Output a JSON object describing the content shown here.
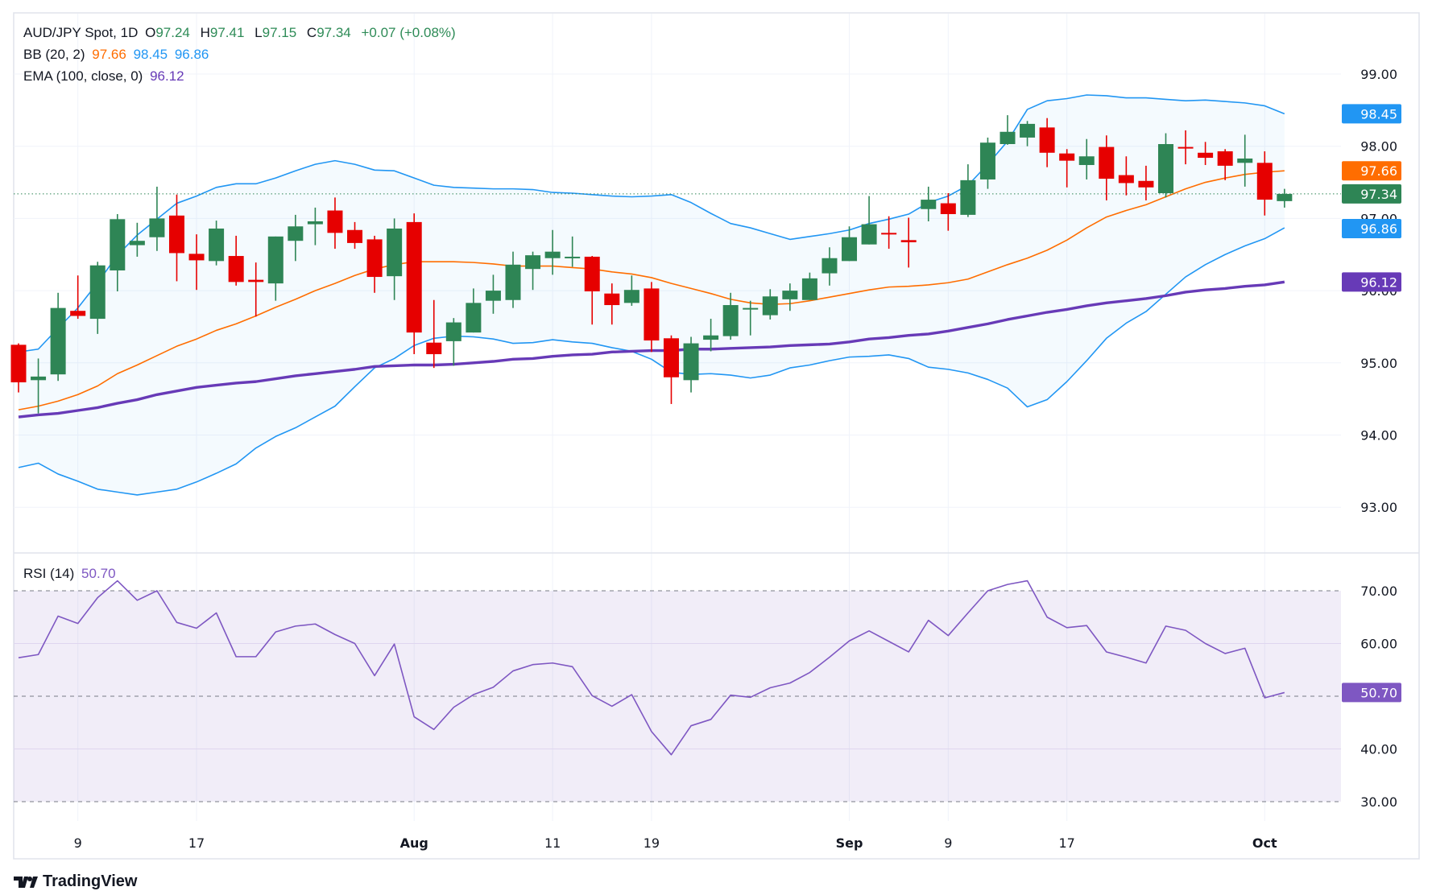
{
  "header": {
    "symbol": "AUD/JPY Spot, 1D",
    "open_label": "O",
    "open": "97.24",
    "high_label": "H",
    "high": "97.41",
    "low_label": "L",
    "low": "97.15",
    "close_label": "C",
    "close": "97.34",
    "change": "+0.07 (+0.08%)"
  },
  "bb_legend": {
    "label": "BB (20, 2)",
    "basis": "97.66",
    "upper": "98.45",
    "lower": "96.86"
  },
  "ema_legend": {
    "label": "EMA (100, close, 0)",
    "value": "96.12"
  },
  "rsi_legend": {
    "label": "RSI (14)",
    "value": "50.70"
  },
  "brand": "TradingView",
  "colors": {
    "up": "#2e8555",
    "down": "#e60000",
    "bb_band": "#2196f3",
    "bb_basis": "#ff6d00",
    "ema": "#673ab7",
    "rsi": "#7e57c2"
  },
  "chart_data": [
    {
      "type": "candlestick",
      "ylim": [
        92.4,
        99.6
      ],
      "price_ticks": [
        "99.00",
        "98.00",
        "97.00",
        "96.00",
        "95.00",
        "94.00",
        "93.00"
      ],
      "time_ticks": [
        {
          "label": "9",
          "date": "Jul 9"
        },
        {
          "label": "17",
          "date": "Jul 17"
        },
        {
          "label": "Aug",
          "date": "Aug 1"
        },
        {
          "label": "11",
          "date": "Aug 12"
        },
        {
          "label": "19",
          "date": "Aug 19"
        },
        {
          "label": "Sep",
          "date": "Sep 2"
        },
        {
          "label": "9",
          "date": "Sep 9"
        },
        {
          "label": "17",
          "date": "Sep 17"
        },
        {
          "label": "Oct",
          "date": "Oct 1"
        }
      ],
      "dates": [
        "Jul 4",
        "Jul 5",
        "Jul 8",
        "Jul 9",
        "Jul 10",
        "Jul 11",
        "Jul 12",
        "Jul 15",
        "Jul 16",
        "Jul 17",
        "Jul 18",
        "Jul 19",
        "Jul 22",
        "Jul 23",
        "Jul 24",
        "Jul 25",
        "Jul 26",
        "Jul 29",
        "Jul 30",
        "Jul 31",
        "Aug 1",
        "Aug 2",
        "Aug 5",
        "Aug 6",
        "Aug 7",
        "Aug 8",
        "Aug 9",
        "Aug 12",
        "Aug 13",
        "Aug 14",
        "Aug 15",
        "Aug 16",
        "Aug 19",
        "Aug 20",
        "Aug 21",
        "Aug 22",
        "Aug 23",
        "Aug 26",
        "Aug 27",
        "Aug 28",
        "Aug 29",
        "Aug 30",
        "Sep 2",
        "Sep 3",
        "Sep 4",
        "Sep 5",
        "Sep 6",
        "Sep 9",
        "Sep 10",
        "Sep 11",
        "Sep 12",
        "Sep 13",
        "Sep 16",
        "Sep 17",
        "Sep 18",
        "Sep 19",
        "Sep 20",
        "Sep 23",
        "Sep 24",
        "Sep 25",
        "Sep 26",
        "Sep 27",
        "Sep 30",
        "Oct 1",
        "Oct 2"
      ],
      "ohlc": [
        [
          95.25,
          95.27,
          94.59,
          94.73
        ],
        [
          94.76,
          95.06,
          94.3,
          94.81
        ],
        [
          94.84,
          95.97,
          94.75,
          95.76
        ],
        [
          95.72,
          96.21,
          95.61,
          95.65
        ],
        [
          95.61,
          96.4,
          95.4,
          96.35
        ],
        [
          96.28,
          97.06,
          95.99,
          96.99
        ],
        [
          96.63,
          96.94,
          96.47,
          96.69
        ],
        [
          96.74,
          97.44,
          96.55,
          97.0
        ],
        [
          97.04,
          97.33,
          96.13,
          96.52
        ],
        [
          96.51,
          96.78,
          96.01,
          96.42
        ],
        [
          96.41,
          96.97,
          96.35,
          96.86
        ],
        [
          96.48,
          96.76,
          96.07,
          96.12
        ],
        [
          96.15,
          96.39,
          95.64,
          96.12
        ],
        [
          96.1,
          96.75,
          95.86,
          96.75
        ],
        [
          96.69,
          97.05,
          96.41,
          96.89
        ],
        [
          96.92,
          97.15,
          96.63,
          96.96
        ],
        [
          97.11,
          97.29,
          96.58,
          96.8
        ],
        [
          96.84,
          96.95,
          96.58,
          96.66
        ],
        [
          96.71,
          96.76,
          95.97,
          96.19
        ],
        [
          96.2,
          97.0,
          95.87,
          96.86
        ],
        [
          96.95,
          97.07,
          95.12,
          95.42
        ],
        [
          95.28,
          95.87,
          94.93,
          95.12
        ],
        [
          95.3,
          95.62,
          94.96,
          95.56
        ],
        [
          95.42,
          96.03,
          95.42,
          95.83
        ],
        [
          95.86,
          96.22,
          95.68,
          96.0
        ],
        [
          95.87,
          96.54,
          95.76,
          96.36
        ],
        [
          96.3,
          96.54,
          96.01,
          96.49
        ],
        [
          96.45,
          96.84,
          96.22,
          96.54
        ],
        [
          96.46,
          96.75,
          96.33,
          96.47
        ],
        [
          96.47,
          96.48,
          95.53,
          95.99
        ],
        [
          95.96,
          96.1,
          95.53,
          95.8
        ],
        [
          95.83,
          96.21,
          95.79,
          96.01
        ],
        [
          96.03,
          96.12,
          95.15,
          95.31
        ],
        [
          95.34,
          95.38,
          94.43,
          94.8
        ],
        [
          94.76,
          95.36,
          94.59,
          95.27
        ],
        [
          95.32,
          95.61,
          95.16,
          95.38
        ],
        [
          95.37,
          95.97,
          95.32,
          95.8
        ],
        [
          95.75,
          95.86,
          95.38,
          95.76
        ],
        [
          95.66,
          96.02,
          95.6,
          95.92
        ],
        [
          95.88,
          96.1,
          95.72,
          96.0
        ],
        [
          95.87,
          96.25,
          95.87,
          96.17
        ],
        [
          96.24,
          96.6,
          96.07,
          96.45
        ],
        [
          96.41,
          96.89,
          96.41,
          96.74
        ],
        [
          96.64,
          97.31,
          96.64,
          96.92
        ],
        [
          96.8,
          97.03,
          96.58,
          96.78
        ],
        [
          96.7,
          97.01,
          96.32,
          96.67
        ],
        [
          97.13,
          97.44,
          96.96,
          97.26
        ],
        [
          97.21,
          97.35,
          96.83,
          97.06
        ],
        [
          97.05,
          97.75,
          97.02,
          97.53
        ],
        [
          97.54,
          98.12,
          97.41,
          98.05
        ],
        [
          98.03,
          98.43,
          98.02,
          98.2
        ],
        [
          98.12,
          98.35,
          98.0,
          98.31
        ],
        [
          98.26,
          98.39,
          97.71,
          97.91
        ],
        [
          97.9,
          97.96,
          97.43,
          97.8
        ],
        [
          97.74,
          98.1,
          97.54,
          97.86
        ],
        [
          97.99,
          98.15,
          97.25,
          97.55
        ],
        [
          97.6,
          97.86,
          97.32,
          97.49
        ],
        [
          97.52,
          97.73,
          97.25,
          97.43
        ],
        [
          97.35,
          98.18,
          97.29,
          98.03
        ],
        [
          97.99,
          98.22,
          97.75,
          97.97
        ],
        [
          97.91,
          98.06,
          97.74,
          97.84
        ],
        [
          97.93,
          97.96,
          97.53,
          97.73
        ],
        [
          97.77,
          98.16,
          97.44,
          97.83
        ],
        [
          97.77,
          97.93,
          97.04,
          97.26
        ],
        [
          97.24,
          97.41,
          97.15,
          97.34
        ]
      ],
      "bb_upper": [
        95.15,
        95.19,
        95.48,
        95.76,
        96.11,
        96.49,
        96.77,
        96.99,
        97.21,
        97.31,
        97.43,
        97.48,
        97.48,
        97.56,
        97.66,
        97.75,
        97.8,
        97.75,
        97.67,
        97.66,
        97.56,
        97.46,
        97.43,
        97.42,
        97.41,
        97.41,
        97.4,
        97.36,
        97.35,
        97.33,
        97.31,
        97.3,
        97.31,
        97.33,
        97.22,
        97.07,
        96.93,
        96.87,
        96.79,
        96.71,
        96.75,
        96.79,
        96.84,
        96.93,
        96.99,
        97.06,
        97.22,
        97.31,
        97.46,
        97.75,
        98.07,
        98.51,
        98.63,
        98.66,
        98.71,
        98.7,
        98.67,
        98.67,
        98.65,
        98.63,
        98.64,
        98.62,
        98.6,
        98.56,
        98.45
      ],
      "bb_basis": [
        94.35,
        94.4,
        94.47,
        94.56,
        94.68,
        94.85,
        94.97,
        95.1,
        95.23,
        95.33,
        95.45,
        95.54,
        95.65,
        95.77,
        95.88,
        96.0,
        96.1,
        96.21,
        96.3,
        96.36,
        96.4,
        96.4,
        96.4,
        96.39,
        96.37,
        96.34,
        96.34,
        96.34,
        96.32,
        96.3,
        96.26,
        96.23,
        96.18,
        96.1,
        96.03,
        95.96,
        95.88,
        95.83,
        95.81,
        95.82,
        95.86,
        95.91,
        95.96,
        96.01,
        96.05,
        96.06,
        96.08,
        96.11,
        96.16,
        96.26,
        96.36,
        96.45,
        96.56,
        96.7,
        96.87,
        97.02,
        97.11,
        97.19,
        97.3,
        97.41,
        97.5,
        97.56,
        97.61,
        97.64,
        97.66
      ],
      "bb_lower": [
        93.55,
        93.61,
        93.46,
        93.36,
        93.25,
        93.21,
        93.17,
        93.21,
        93.25,
        93.35,
        93.47,
        93.6,
        93.82,
        93.98,
        94.1,
        94.25,
        94.4,
        94.67,
        94.93,
        95.06,
        95.24,
        95.34,
        95.37,
        95.36,
        95.33,
        95.27,
        95.28,
        95.32,
        95.29,
        95.27,
        95.21,
        95.16,
        95.05,
        94.87,
        94.84,
        94.85,
        94.83,
        94.79,
        94.83,
        94.93,
        94.97,
        95.03,
        95.08,
        95.09,
        95.11,
        95.06,
        94.94,
        94.91,
        94.86,
        94.77,
        94.65,
        94.39,
        94.49,
        94.74,
        95.03,
        95.34,
        95.55,
        95.71,
        95.95,
        96.19,
        96.36,
        96.5,
        96.62,
        96.72,
        96.87
      ],
      "ema100": [
        94.25,
        94.28,
        94.3,
        94.34,
        94.38,
        94.44,
        94.49,
        94.56,
        94.61,
        94.66,
        94.69,
        94.72,
        94.74,
        94.78,
        94.82,
        94.85,
        94.88,
        94.91,
        94.95,
        94.96,
        94.97,
        94.97,
        94.98,
        95.0,
        95.02,
        95.05,
        95.06,
        95.09,
        95.11,
        95.12,
        95.15,
        95.16,
        95.17,
        95.17,
        95.19,
        95.19,
        95.2,
        95.21,
        95.22,
        95.24,
        95.25,
        95.26,
        95.29,
        95.33,
        95.35,
        95.38,
        95.4,
        95.44,
        95.49,
        95.54,
        95.6,
        95.65,
        95.7,
        95.74,
        95.79,
        95.83,
        95.86,
        95.89,
        95.93,
        95.98,
        96.01,
        96.03,
        96.06,
        96.08,
        96.12
      ],
      "last_price": 97.34,
      "price_tags": [
        {
          "value": "98.45",
          "color": "#2196f3"
        },
        {
          "value": "97.66",
          "color": "#ff6d00"
        },
        {
          "value": "97.34",
          "color": "#2e8555"
        },
        {
          "value": "96.86",
          "color": "#2196f3"
        },
        {
          "value": "96.12",
          "color": "#673ab7"
        }
      ]
    },
    {
      "type": "line",
      "ylim": [
        25,
        75
      ],
      "ticks": [
        "70.00",
        "60.00",
        "50.00",
        "40.00",
        "30.00"
      ],
      "band": [
        30,
        70
      ],
      "midline": 50,
      "rsi": [
        57.3,
        57.9,
        65.2,
        63.8,
        68.7,
        71.9,
        68.2,
        70.0,
        64.0,
        62.9,
        65.8,
        57.5,
        57.5,
        62.2,
        63.3,
        63.7,
        61.7,
        60.0,
        53.9,
        59.9,
        46.1,
        43.7,
        47.9,
        50.3,
        51.7,
        54.8,
        56.0,
        56.3,
        55.6,
        50.1,
        48.1,
        50.3,
        43.3,
        38.9,
        44.4,
        45.6,
        50.2,
        49.8,
        51.6,
        52.5,
        54.5,
        57.4,
        60.5,
        62.4,
        60.4,
        58.4,
        64.4,
        61.5,
        65.8,
        70.0,
        71.2,
        71.9,
        65.0,
        63.0,
        63.4,
        58.4,
        57.4,
        56.3,
        63.3,
        62.5,
        60.0,
        58.1,
        59.1,
        49.7,
        50.7
      ],
      "tag": {
        "value": "50.70",
        "color": "#7e57c2"
      }
    }
  ]
}
